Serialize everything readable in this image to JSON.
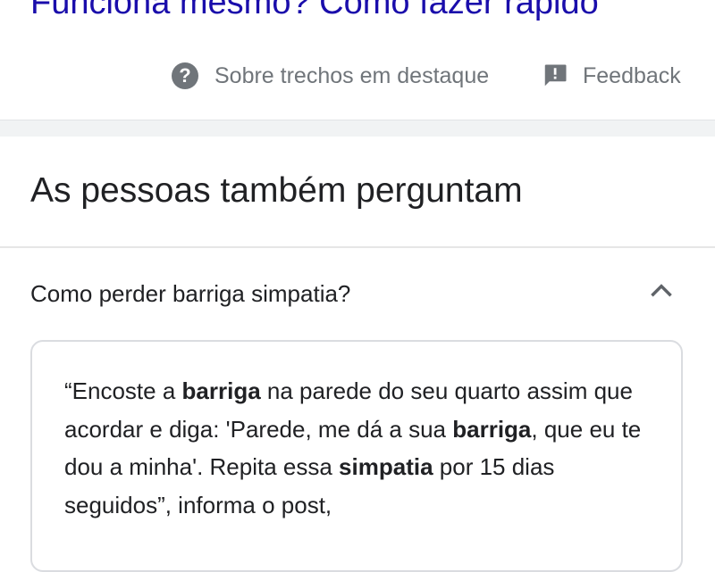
{
  "result": {
    "title_partial": "Funciona mesmo? Como fazer rápido"
  },
  "snippet_meta": {
    "about_label": "Sobre trechos em destaque",
    "about_icon": "help-circle-icon",
    "feedback_label": "Feedback",
    "feedback_icon": "feedback-flag-icon"
  },
  "people_also_ask": {
    "heading": "As pessoas também perguntam",
    "question": "Como perder barriga simpatia?",
    "chevron_icon": "chevron-up-icon",
    "answer_parts": {
      "p1": "“Encoste a ",
      "b1": "barriga",
      "p2": " na parede do seu quarto assim que acordar e diga: 'Parede, me dá a sua ",
      "b2": "barriga",
      "p3": ", que eu te dou a minha'. Repita essa ",
      "b3": "simpatia",
      "p4": " por 15 dias seguidos”, informa o post,"
    }
  },
  "colors": {
    "link": "#1a0dab",
    "muted_text": "#70757a",
    "body_text": "#202124",
    "separator_band": "#f1f3f4"
  }
}
